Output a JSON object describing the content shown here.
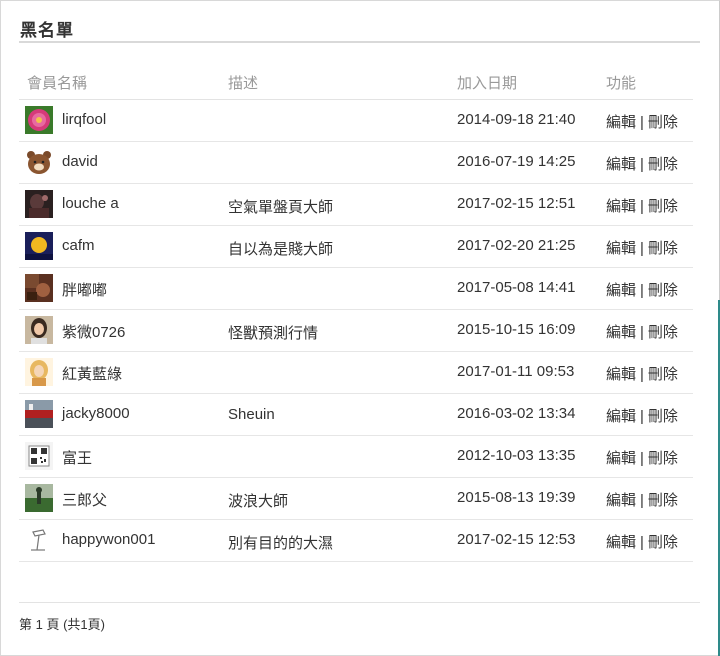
{
  "page": {
    "title": "黑名單"
  },
  "table": {
    "headers": {
      "name": "會員名稱",
      "description": "描述",
      "date": "加入日期",
      "actions": "功能"
    },
    "rows": [
      {
        "avatar": "pink-flower-avatar",
        "name": "lirqfool",
        "description": "",
        "date": "2014-09-18 21:40"
      },
      {
        "avatar": "brown-bear-avatar",
        "name": "david",
        "description": "",
        "date": "2016-07-19 14:25"
      },
      {
        "avatar": "dark-photo-avatar",
        "name": "louche a",
        "description": "空氣單盤頁大師",
        "date": "2017-02-15 12:51"
      },
      {
        "avatar": "night-moon-avatar",
        "name": "cafm",
        "description": "自以為是賤大師",
        "date": "2017-02-20 21:25"
      },
      {
        "avatar": "brown-photo-avatar",
        "name": "胖嘟嘟",
        "description": "",
        "date": "2017-05-08 14:41"
      },
      {
        "avatar": "girl-photo-avatar",
        "name": "紫微0726",
        "description": "怪獸預測行情",
        "date": "2015-10-15 16:09"
      },
      {
        "avatar": "blonde-figure-avatar",
        "name": "紅黃藍綠",
        "description": "",
        "date": "2017-01-11 09:53"
      },
      {
        "avatar": "red-street-avatar",
        "name": "jacky8000",
        "description": "Sheuin",
        "date": "2016-03-02 13:34"
      },
      {
        "avatar": "qrcode-avatar",
        "name": "富王",
        "description": "",
        "date": "2012-10-03 13:35"
      },
      {
        "avatar": "green-field-avatar",
        "name": "三郎父",
        "description": "波浪大師",
        "date": "2015-08-13 19:39"
      },
      {
        "avatar": "lamp-sketch-avatar",
        "name": "happywon001",
        "description": "別有目的的大濕",
        "date": "2017-02-15 12:53"
      }
    ],
    "edit_label": "編輯",
    "delete_label": "刪除",
    "separator": "|"
  },
  "pagination": {
    "text": "第 1 頁 (共1頁)"
  },
  "colors": {
    "accent_edge": "#2e8a8a",
    "rule": "#d9d9d9",
    "header_text": "#999999"
  }
}
